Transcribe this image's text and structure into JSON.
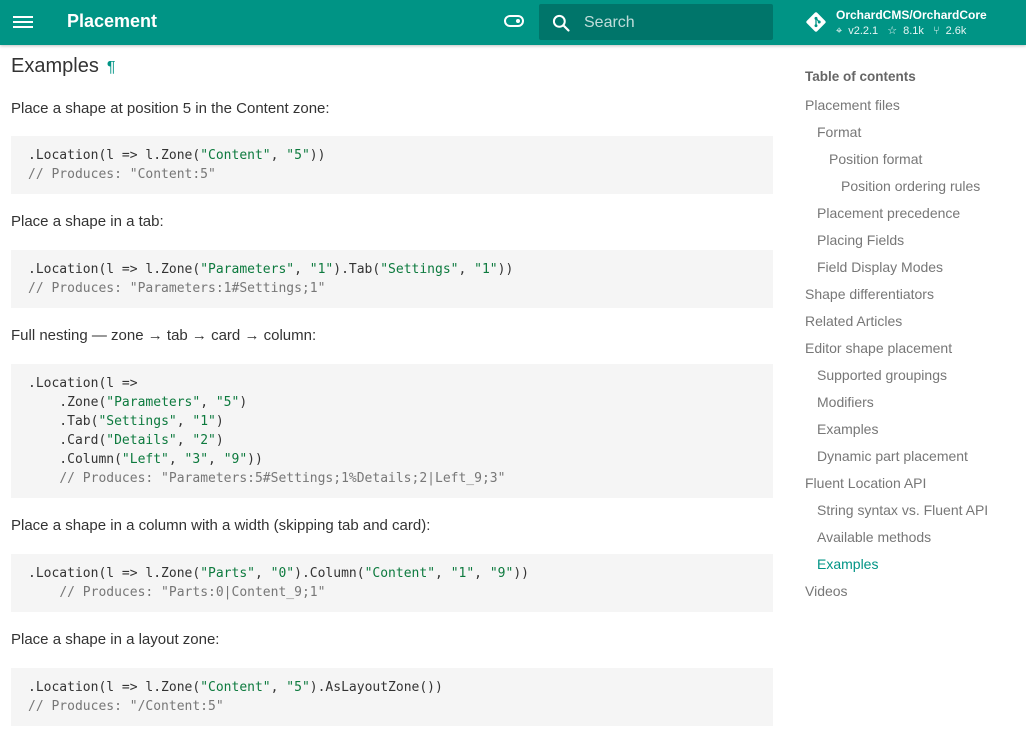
{
  "header": {
    "title": "Placement",
    "search_placeholder": "Search",
    "repo": {
      "name": "OrchardCMS/OrchardCore",
      "version": "v2.2.1",
      "stars": "8.1k",
      "forks": "2.6k"
    },
    "accent_color": "#009485"
  },
  "content": {
    "heading": "Examples",
    "pilcrow": "¶",
    "examples": [
      {
        "description": "Place a shape at position 5 in the Content zone:",
        "code": [
          ".Location(l => l.Zone(\"Content\", \"5\"))",
          "// Produces: \"Content:5\""
        ]
      },
      {
        "description": "Place a shape in a tab:",
        "code": [
          ".Location(l => l.Zone(\"Parameters\", \"1\").Tab(\"Settings\", \"1\"))",
          "// Produces: \"Parameters:1#Settings;1\""
        ]
      },
      {
        "description": "Full nesting — zone → tab → card → column:",
        "code": [
          ".Location(l =>",
          "    .Zone(\"Parameters\", \"5\")",
          "    .Tab(\"Settings\", \"1\")",
          "    .Card(\"Details\", \"2\")",
          "    .Column(\"Left\", \"3\", \"9\"))",
          "    // Produces: \"Parameters:5#Settings;1%Details;2|Left_9;3\""
        ]
      },
      {
        "description": "Place a shape in a column with a width (skipping tab and card):",
        "code": [
          ".Location(l => l.Zone(\"Parts\", \"0\").Column(\"Content\", \"1\", \"9\"))",
          "    // Produces: \"Parts:0|Content_9;1\""
        ]
      },
      {
        "description": "Place a shape in a layout zone:",
        "code": [
          ".Location(l => l.Zone(\"Content\", \"5\").AsLayoutZone())",
          "// Produces: \"/Content:5\""
        ]
      }
    ]
  },
  "toc": {
    "heading": "Table of contents",
    "items": [
      {
        "label": "Placement files",
        "level": 0
      },
      {
        "label": "Format",
        "level": 1
      },
      {
        "label": "Position format",
        "level": 2
      },
      {
        "label": "Position ordering rules",
        "level": 3
      },
      {
        "label": "Placement precedence",
        "level": 1
      },
      {
        "label": "Placing Fields",
        "level": 1
      },
      {
        "label": "Field Display Modes",
        "level": 1
      },
      {
        "label": "Shape differentiators",
        "level": 0
      },
      {
        "label": "Related Articles",
        "level": 0
      },
      {
        "label": "Editor shape placement",
        "level": 0
      },
      {
        "label": "Supported groupings",
        "level": 1
      },
      {
        "label": "Modifiers",
        "level": 1
      },
      {
        "label": "Examples",
        "level": 1
      },
      {
        "label": "Dynamic part placement",
        "level": 1
      },
      {
        "label": "Fluent Location API",
        "level": 0
      },
      {
        "label": "String syntax vs. Fluent API",
        "level": 1
      },
      {
        "label": "Available methods",
        "level": 1
      },
      {
        "label": "Examples",
        "level": 1,
        "active": true
      },
      {
        "label": "Videos",
        "level": 0
      }
    ]
  }
}
